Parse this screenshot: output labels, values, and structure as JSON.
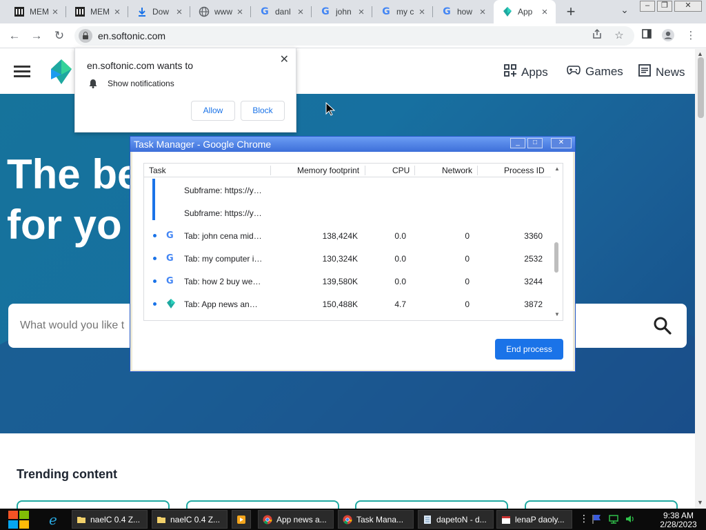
{
  "browser": {
    "tabs": [
      {
        "title": "MEM",
        "icon": "bank-icon"
      },
      {
        "title": "MEM",
        "icon": "bank-icon"
      },
      {
        "title": "Dow",
        "icon": "download-icon"
      },
      {
        "title": "www",
        "icon": "globe-icon"
      },
      {
        "title": "danl",
        "icon": "google-icon"
      },
      {
        "title": "john",
        "icon": "google-icon"
      },
      {
        "title": "my c",
        "icon": "google-icon"
      },
      {
        "title": "how",
        "icon": "google-icon"
      },
      {
        "title": "App",
        "icon": "softonic-icon",
        "active": true
      }
    ],
    "url": "en.softonic.com"
  },
  "site": {
    "nav": [
      {
        "label": "Apps",
        "icon": "apps-grid-icon"
      },
      {
        "label": "Games",
        "icon": "gamepad-icon"
      },
      {
        "label": "News",
        "icon": "newspaper-icon"
      }
    ],
    "hero_title": "The be\nfor yo",
    "search_placeholder": "What would you like t",
    "trending_heading": "Trending content"
  },
  "notification": {
    "title": "en.softonic.com wants to",
    "permission": "Show notifications",
    "allow_label": "Allow",
    "block_label": "Block"
  },
  "task_manager": {
    "title": "Task Manager - Google Chrome",
    "columns": [
      "Task",
      "Memory footprint",
      "CPU",
      "Network",
      "Process ID"
    ],
    "rows": [
      {
        "task": "Subframe: https://y…",
        "memory": "",
        "cpu": "",
        "network": "",
        "pid": "",
        "icon": ""
      },
      {
        "task": "Subframe: https://y…",
        "memory": "",
        "cpu": "",
        "network": "",
        "pid": "",
        "icon": ""
      },
      {
        "task": "Tab: john cena mid…",
        "memory": "138,424K",
        "cpu": "0.0",
        "network": "0",
        "pid": "3360",
        "icon": "google-icon"
      },
      {
        "task": "Tab: my computer i…",
        "memory": "130,324K",
        "cpu": "0.0",
        "network": "0",
        "pid": "2532",
        "icon": "google-icon"
      },
      {
        "task": "Tab: how 2 buy we…",
        "memory": "139,580K",
        "cpu": "0.0",
        "network": "0",
        "pid": "3244",
        "icon": "google-icon"
      },
      {
        "task": "Tab: App news an…",
        "memory": "150,488K",
        "cpu": "4.7",
        "network": "0",
        "pid": "3872",
        "icon": "softonic-icon"
      }
    ],
    "end_process_label": "End process"
  },
  "taskbar": {
    "buttons": [
      {
        "label": "naelC 0.4 Z...",
        "icon": "folder-icon"
      },
      {
        "label": "naelC 0.4 Z...",
        "icon": "folder-icon"
      },
      {
        "label": "",
        "icon": "media-player-icon"
      },
      {
        "label": "App news a...",
        "icon": "chrome-icon"
      },
      {
        "label": "Task Mana...",
        "icon": "chrome-icon"
      },
      {
        "label": "dapetoN - d...",
        "icon": "notepad-icon"
      },
      {
        "label": "lenaP daoly...",
        "icon": "calendar-icon"
      }
    ],
    "time": "9:38 AM",
    "date": "2/28/2023"
  }
}
